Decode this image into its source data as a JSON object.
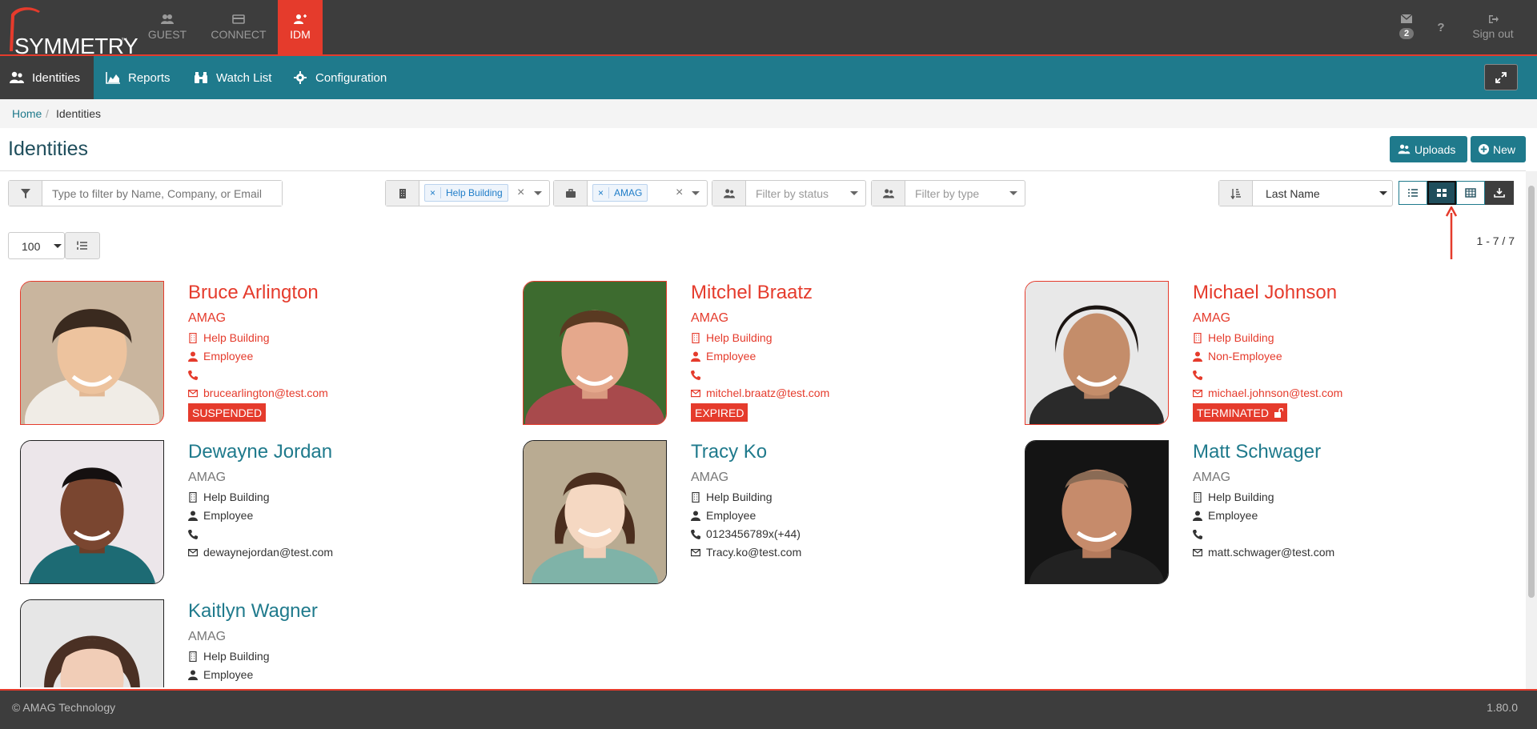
{
  "app": {
    "logo_text": "SYMMETRY",
    "logo_tm": "™",
    "apps": [
      {
        "label": "GUEST",
        "icon": "users-icon"
      },
      {
        "label": "CONNECT",
        "icon": "card-icon"
      },
      {
        "label": "IDM",
        "icon": "user-plus-icon"
      }
    ],
    "notifications_count": "2",
    "help_label": "?",
    "signout_label": "Sign out"
  },
  "nav": {
    "items": [
      {
        "label": "Identities",
        "icon": "users-icon"
      },
      {
        "label": "Reports",
        "icon": "area-chart-icon"
      },
      {
        "label": "Watch List",
        "icon": "binoculars-icon"
      },
      {
        "label": "Configuration",
        "icon": "gear-icon"
      }
    ]
  },
  "breadcrumb": {
    "home": "Home",
    "sep": "/",
    "current": "Identities"
  },
  "page": {
    "title": "Identities",
    "uploads_label": "Uploads",
    "new_label": "New"
  },
  "filters": {
    "search_placeholder": "Type to filter by Name, Company, or Email",
    "building_tag": "Help Building",
    "company_tag": "AMAG",
    "tag_remove": "×",
    "clear": "×",
    "status_placeholder": "Filter by status",
    "type_placeholder": "Filter by type",
    "sort_value": "Last Name",
    "page_size": "100"
  },
  "results_count": "1 - 7 / 7",
  "identities": [
    {
      "name": "Bruce Arlington",
      "company": "AMAG",
      "building": "Help Building",
      "type": "Employee",
      "phone": "",
      "email": "brucearlington@test.com",
      "status": "SUSPENDED",
      "alert": true
    },
    {
      "name": "Mitchel Braatz",
      "company": "AMAG",
      "building": "Help Building",
      "type": "Employee",
      "phone": "",
      "email": "mitchel.braatz@test.com",
      "status": "EXPIRED",
      "alert": true
    },
    {
      "name": "Michael Johnson",
      "company": "AMAG",
      "building": "Help Building",
      "type": "Non-Employee",
      "phone": "",
      "email": "michael.johnson@test.com",
      "status": "TERMINATED",
      "alert": true
    },
    {
      "name": "Dewayne Jordan",
      "company": "AMAG",
      "building": "Help Building",
      "type": "Employee",
      "phone": "",
      "email": "dewaynejordan@test.com",
      "status": "",
      "alert": false
    },
    {
      "name": "Tracy Ko",
      "company": "AMAG",
      "building": "Help Building",
      "type": "Employee",
      "phone": "0123456789x(+44)",
      "email": "Tracy.ko@test.com",
      "status": "",
      "alert": false
    },
    {
      "name": "Matt Schwager",
      "company": "AMAG",
      "building": "Help Building",
      "type": "Employee",
      "phone": "",
      "email": "matt.schwager@test.com",
      "status": "",
      "alert": false
    },
    {
      "name": "Kaitlyn Wagner",
      "company": "AMAG",
      "building": "Help Building",
      "type": "Employee",
      "phone": "",
      "email": "",
      "status": "",
      "alert": false
    }
  ],
  "footer": {
    "copyright": "© AMAG Technology",
    "version": "1.80.0"
  },
  "colors": {
    "brand_red": "#e53b2c",
    "nav_teal": "#1f7a8c",
    "dark": "#3d3d3d"
  }
}
